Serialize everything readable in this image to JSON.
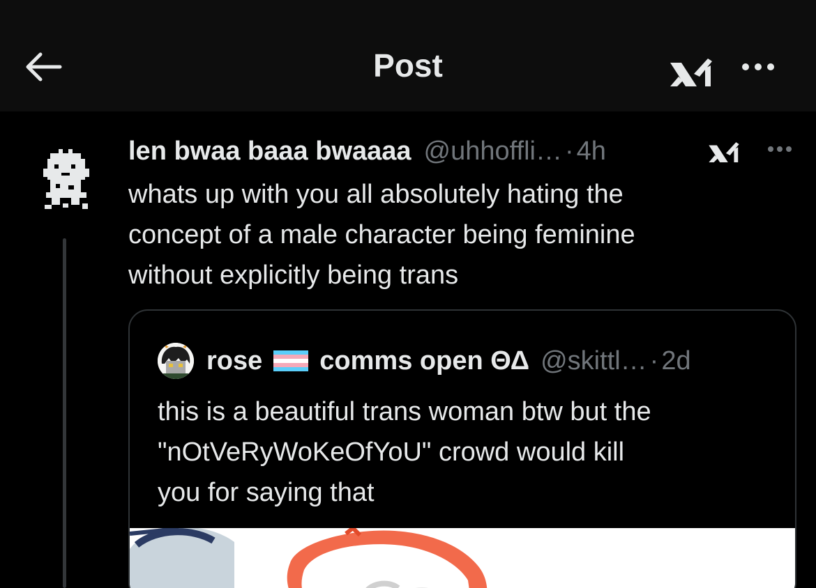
{
  "header": {
    "title": "Post",
    "back_icon": "arrow-left-icon",
    "grok_icon": "grok-icon",
    "more_icon": "more-horizontal-icon"
  },
  "post": {
    "display_name": "len bwaa baaa bwaaaa",
    "handle": "@uhhoffli…",
    "separator": "·",
    "time": "4h",
    "text_lines": [
      "whats up with you all absolutely hating the",
      "concept of a male character being feminine",
      "without explicitly being trans"
    ]
  },
  "quote": {
    "name_part1": "rose",
    "flag": "transgender-flag-icon",
    "name_part2": "comms open ΘΔ",
    "handle": "@skittl…",
    "separator": "·",
    "time": "2d",
    "text_lines": [
      "this is a beautiful trans woman btw but the",
      "\"nOtVeRyWoKeOfYoU\" crowd would kill",
      "you for saying that"
    ]
  },
  "colors": {
    "background": "#000000",
    "topbar": "#0d0d0d",
    "text_primary": "#e7e9ea",
    "text_secondary": "#71767b",
    "border": "#2f3336",
    "flag_blue": "#5bcefa",
    "flag_pink": "#f5a9b8",
    "media_accent": "#f26a4b"
  }
}
